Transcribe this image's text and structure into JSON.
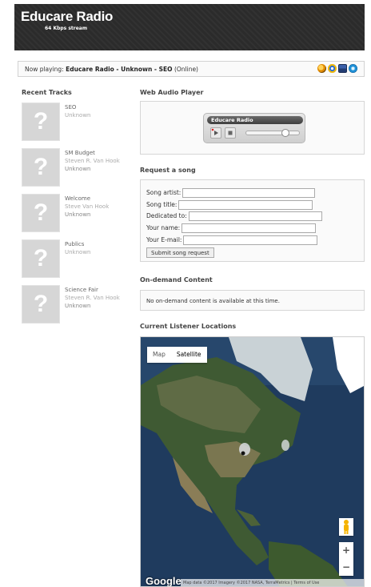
{
  "header": {
    "title": "Educare Radio",
    "subtitle": "64 Kbps stream"
  },
  "now_playing": {
    "label": "Now playing:",
    "track": "Educare Radio - Unknown - SEO",
    "status": "(Online)",
    "icons": [
      "winamp-icon",
      "realplayer-icon",
      "windows-media-icon",
      "quicktime-icon"
    ]
  },
  "recent_tracks": {
    "title": "Recent Tracks",
    "placeholder_glyph": "?",
    "items": [
      {
        "title": "SEO",
        "artist": "Unknown",
        "album": ""
      },
      {
        "title": "SM Budget",
        "artist": "Steven R. Van Hook",
        "album": "Unknown"
      },
      {
        "title": "Welcome",
        "artist": "Steve Van Hook",
        "album": "Unknown"
      },
      {
        "title": "Publics",
        "artist": "Unknown",
        "album": ""
      },
      {
        "title": "Science Fair",
        "artist": "Steven R. Van Hook",
        "album": "Unknown"
      }
    ]
  },
  "web_player": {
    "title": "Web Audio Player",
    "station": "Educare Radio"
  },
  "request": {
    "title": "Request a song",
    "fields": [
      {
        "label": "Song artist:",
        "value": ""
      },
      {
        "label": "Song title:",
        "value": ""
      },
      {
        "label": "Dedicated to:",
        "value": ""
      },
      {
        "label": "Your name:",
        "value": ""
      },
      {
        "label": "Your E-mail:",
        "value": ""
      }
    ],
    "submit_label": "Submit song request"
  },
  "on_demand": {
    "title": "On-demand Content",
    "message": "No on-demand content is available at this time."
  },
  "listeners": {
    "title": "Current Listener Locations",
    "map_type_map": "Map",
    "map_type_satellite": "Satellite",
    "zoom_in": "+",
    "zoom_out": "−",
    "logo": "Google",
    "attribution": "Map data ©2017 Imagery ©2017 NASA, TerraMetrics  |  Terms of Use"
  },
  "colors": {
    "header_bg": "#2b2b2b",
    "placeholder_bg": "#d6d6d6",
    "ocean": "#1f3b5e",
    "land": "#3f5a33"
  }
}
